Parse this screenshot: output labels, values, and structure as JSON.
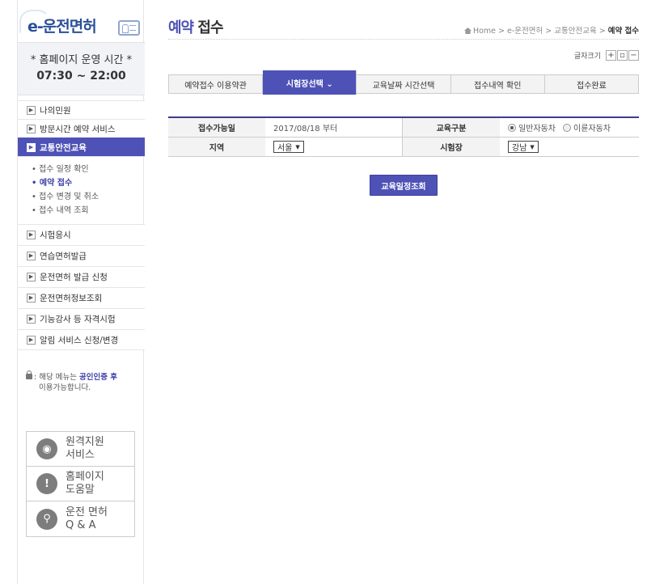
{
  "logo": {
    "text": "e-운전면허"
  },
  "hours": {
    "title": "* 홈페이지 운영 시간 *",
    "time": "07:30 ~ 22:00"
  },
  "menu": {
    "items_top": [
      {
        "label": "나의민원"
      },
      {
        "label": "방문시간 예약 서비스"
      },
      {
        "label": "교통안전교육"
      }
    ],
    "submenu": [
      {
        "label": "• 접수 일정 확인"
      },
      {
        "label": "• 예약 접수"
      },
      {
        "label": "• 접수 변경 및 취소"
      },
      {
        "label": "• 접수 내역 조회"
      }
    ],
    "items_bottom": [
      {
        "label": "시험응시"
      },
      {
        "label": "연습면허발급"
      },
      {
        "label": "운전면허 발급 신청"
      },
      {
        "label": "운전면허정보조회"
      },
      {
        "label": "기능강사 등 자격시험"
      },
      {
        "label": "알림 서비스 신청/변경"
      }
    ]
  },
  "notice": {
    "prefix": ": 해당 메뉴는 ",
    "highlight": "공인인증 후",
    "suffix": "이용가능합니다."
  },
  "help": [
    {
      "icon": "wifi-icon",
      "glyph": "◉",
      "label_1": "원격지원",
      "label_2": "서비스"
    },
    {
      "icon": "alert-icon",
      "glyph": "!",
      "label_1": "홈페이지",
      "label_2": "도움말"
    },
    {
      "icon": "search-icon",
      "glyph": "⚲",
      "label_1": "운전 면허",
      "label_2": "Q & A"
    }
  ],
  "page": {
    "title_accent": "예약",
    "title_rest": " 접수"
  },
  "breadcrumb": {
    "home": "Home",
    "sep": " > ",
    "level1": "e-운전면허",
    "level2": "교통안전교육",
    "current": "예약 접수"
  },
  "fontsize": {
    "label": "글자크기",
    "plus": "+",
    "reset": "▫",
    "minus": "−"
  },
  "steps": [
    {
      "label": "예약접수 이용약관"
    },
    {
      "label": "시험장선택 ⌄"
    },
    {
      "label": "교육날짜 시간선택"
    },
    {
      "label": "접수내역 확인"
    },
    {
      "label": "접수완료"
    }
  ],
  "form": {
    "available_label": "접수가능일",
    "available_value": "2017/08/18 부터",
    "type_label": "교육구분",
    "type_option_1": "일반자동차",
    "type_option_2": "이륜자동차",
    "region_label": "지역",
    "region_value": "서울",
    "site_label": "시험장",
    "site_value": "강남"
  },
  "search_button": "교육일정조회",
  "colors": {
    "accent": "#4e52b6",
    "logo": "#2b4f9a"
  }
}
